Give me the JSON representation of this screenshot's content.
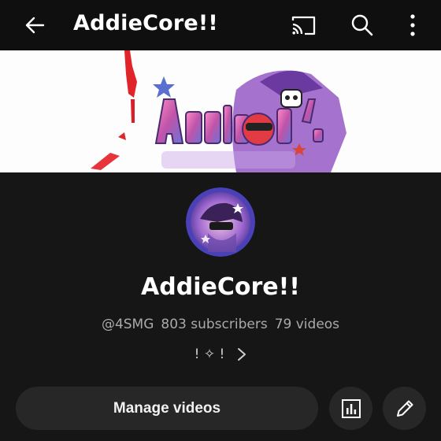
{
  "appbar": {
    "title": "AddieCore!!",
    "icons": [
      "back-arrow-icon",
      "cast-icon",
      "search-icon",
      "more-vert-icon"
    ]
  },
  "banner": {
    "artwork_text": "AddieCore!!"
  },
  "channel": {
    "name": "AddieCore!!",
    "handle": "@4SMG",
    "subscribers": "803 subscribers",
    "videos": "79 videos",
    "description_preview": "! ✧ !"
  },
  "actions": {
    "manage_label": "Manage videos",
    "analytics_icon": "bar-chart-icon",
    "edit_icon": "pencil-icon"
  },
  "colors": {
    "background": "#161616",
    "topbar": "#0f0f0f",
    "button": "#272727",
    "text_primary": "#ffffff",
    "text_secondary": "#aaaaaa"
  }
}
